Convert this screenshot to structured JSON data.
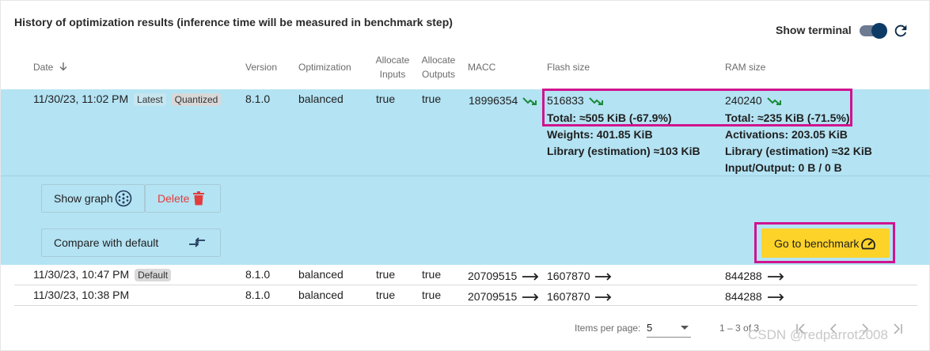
{
  "title": "History of optimization results (inference time will be measured in benchmark step)",
  "terminal": {
    "label": "Show terminal",
    "enabled": true
  },
  "columns": {
    "date": "Date",
    "version": "Version",
    "optimization": "Optimization",
    "allocate_inputs_1": "Allocate",
    "allocate_inputs_2": "Inputs",
    "allocate_outputs_1": "Allocate",
    "allocate_outputs_2": "Outputs",
    "macc": "MACC",
    "flash": "Flash size",
    "ram": "RAM size"
  },
  "selected_row": {
    "date": "11/30/23, 11:02 PM",
    "tag_latest": "Latest",
    "tag_quantized": "Quantized",
    "version": "8.1.0",
    "optimization": "balanced",
    "allocate_inputs": "true",
    "allocate_outputs": "true",
    "macc": "18996354",
    "flash_value": "516833",
    "flash_total": "Total: ≈505 KiB (-67.9%)",
    "flash_weights": "Weights: 401.85 KiB",
    "flash_library": "Library (estimation) ≈103 KiB",
    "ram_value": "240240",
    "ram_total": "Total: ≈235 KiB (-71.5%)",
    "ram_activations": "Activations: 203.05 KiB",
    "ram_library": "Library (estimation) ≈32 KiB",
    "ram_io": "Input/Output: 0 B / 0 B"
  },
  "actions": {
    "show_graph": "Show graph",
    "delete": "Delete",
    "compare": "Compare with default",
    "go_benchmark": "Go to benchmark"
  },
  "rows": [
    {
      "date": "11/30/23, 10:47 PM",
      "tag": "Default",
      "version": "8.1.0",
      "optimization": "balanced",
      "allocate_inputs": "true",
      "allocate_outputs": "true",
      "macc": "20709515",
      "flash": "1607870",
      "ram": "844288"
    },
    {
      "date": "11/30/23, 10:38 PM",
      "tag": "",
      "version": "8.1.0",
      "optimization": "balanced",
      "allocate_inputs": "true",
      "allocate_outputs": "true",
      "macc": "20709515",
      "flash": "1607870",
      "ram": "844288"
    }
  ],
  "pagination": {
    "items_per_page_label": "Items per page:",
    "items_per_page_value": "5",
    "range": "1 – 3 of 3"
  },
  "watermark": "CSDN @redparrot2008",
  "colors": {
    "selected_row_bg": "#b4e3f3",
    "highlight_box": "#d0138f",
    "benchmark_button": "#fdd32a",
    "trend_down": "#1a8a3a",
    "delete_red": "#e23c3c"
  },
  "icons": {
    "sort": "arrow-down-icon",
    "refresh": "refresh-icon",
    "trend": "trending-down-icon",
    "arrow": "arrow-right-icon",
    "graph": "graph-icon",
    "delete": "trash-icon",
    "compare": "compare-arrows-icon",
    "benchmark": "speedometer-icon"
  }
}
